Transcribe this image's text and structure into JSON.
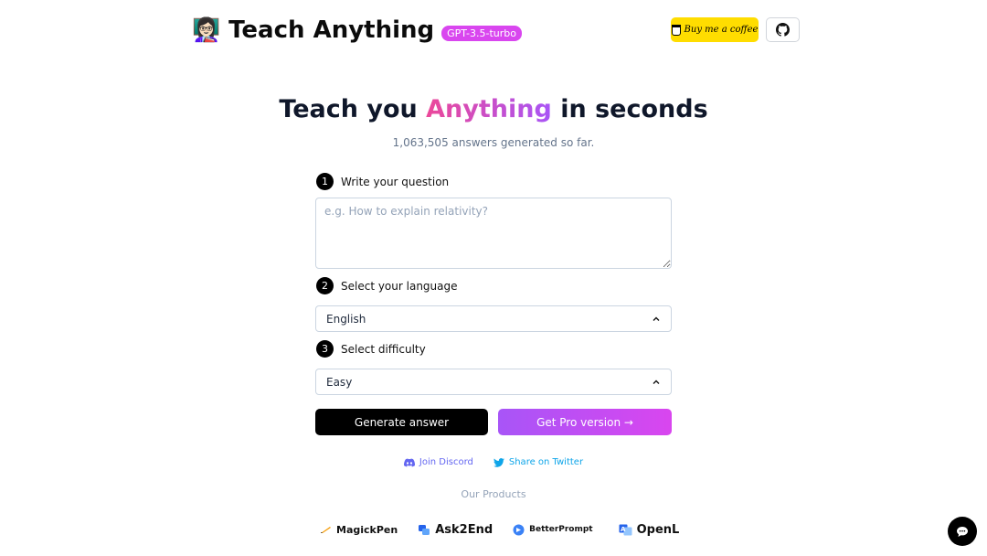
{
  "header": {
    "emoji": "👩🏻‍🏫",
    "title": "Teach Anything",
    "model_badge": "GPT-3.5-turbo",
    "coffee_label": "Buy me a coffee",
    "github_icon": "github-icon"
  },
  "hero": {
    "title_prefix": "Teach you",
    "title_highlight": "Anything",
    "title_suffix": "in seconds",
    "counter": "1,063,505 answers generated so far."
  },
  "steps": [
    {
      "number": "1",
      "label": "Write your question"
    },
    {
      "number": "2",
      "label": "Select your language"
    },
    {
      "number": "3",
      "label": "Select difficulty"
    }
  ],
  "question": {
    "placeholder": "e.g. How to explain relativity?",
    "value": ""
  },
  "language": {
    "selected": "English"
  },
  "difficulty": {
    "selected": "Easy"
  },
  "actions": {
    "generate_label": "Generate answer",
    "pro_label": "Get Pro version →"
  },
  "links": {
    "discord": "Join Discord",
    "twitter": "Share on Twitter"
  },
  "products": {
    "heading": "Our Products",
    "items": [
      "MagickPen",
      "Ask2End",
      "BetterPrompt",
      "OpenL"
    ]
  },
  "colors": {
    "accent_start": "#ec4899",
    "accent_end": "#a855f7",
    "badge": "#d946ef",
    "coffee": "#ffdd00"
  }
}
